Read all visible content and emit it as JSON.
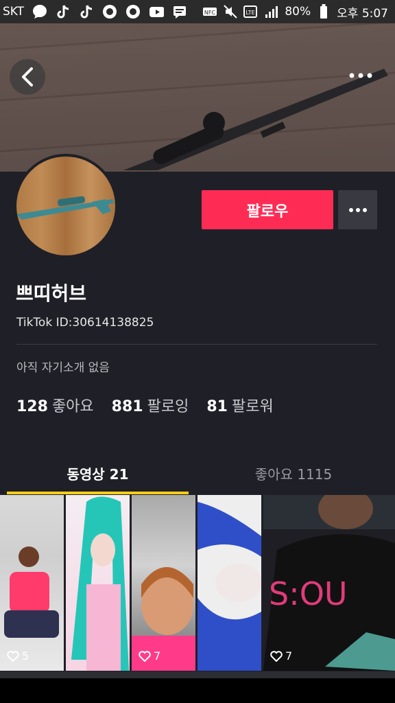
{
  "status_bar": {
    "carrier": "SKT",
    "battery": "80%",
    "time": "오후 5:07",
    "icons": [
      "chat-bubble-icon",
      "tiktok-icon",
      "tiktok-icon",
      "settings-icon",
      "settings-icon",
      "youtube-icon",
      "message-icon",
      "nfc-icon",
      "mute-icon",
      "lte-icon",
      "signal-icon",
      "battery-icon"
    ]
  },
  "profile": {
    "follow_label": "팔로우",
    "username": "쁘띠허브",
    "tiktok_id": "TikTok ID:30614138825",
    "bio": "아직 자기소개 없음"
  },
  "stats": [
    {
      "value": "128",
      "label": "좋아요"
    },
    {
      "value": "881",
      "label": "팔로잉"
    },
    {
      "value": "81",
      "label": "팔로워"
    }
  ],
  "tabs": {
    "videos": "동영상 21",
    "likes": "좋아요 1115"
  },
  "videos": [
    {
      "likes": "5",
      "colors": [
        "#d8d8d8",
        "#ff3b6b"
      ]
    },
    {
      "likes": "",
      "colors": [
        "#25c6b8",
        "#f6b6d4"
      ]
    },
    {
      "likes": "7",
      "colors": [
        "#bcbcbc",
        "#ff3b89"
      ]
    },
    {
      "likes": "",
      "colors": [
        "#2f4fc9",
        "#f0e8e6"
      ]
    },
    {
      "likes": "7",
      "colors": [
        "#1e1e24",
        "#e23b7a"
      ]
    }
  ],
  "colors": {
    "follow": "#fe2c55",
    "tab_indicator": "#face15",
    "background": "#1f2027"
  }
}
